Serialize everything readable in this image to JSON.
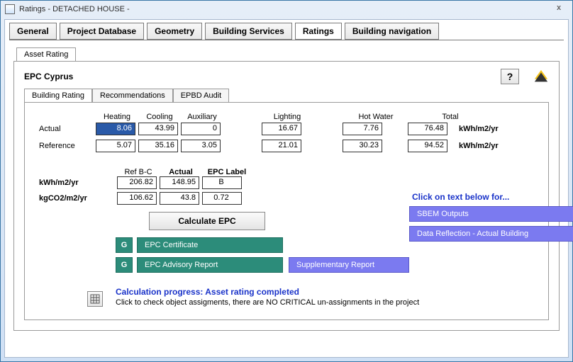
{
  "window": {
    "title": "Ratings - DETACHED HOUSE -",
    "close": "x"
  },
  "mainTabs": {
    "t0": "General",
    "t1": "Project Database",
    "t2": "Geometry",
    "t3": "Building Services",
    "t4": "Ratings",
    "t5": "Building navigation"
  },
  "subTab": "Asset Rating",
  "epcTitle": "EPC Cyprus",
  "helpGlyph": "?",
  "innerTabs": {
    "t0": "Building Rating",
    "t1": "Recommendations",
    "t2": "EPBD Audit"
  },
  "cols": {
    "heating": "Heating",
    "cooling": "Cooling",
    "aux": "Auxiliary",
    "lighting": "Lighting",
    "hotwater": "Hot Water",
    "total": "Total"
  },
  "rows": {
    "actual": "Actual",
    "reference": "Reference"
  },
  "vals": {
    "actual": {
      "heating": "8.06",
      "cooling": "43.99",
      "aux": "0",
      "lighting": "16.67",
      "hotwater": "7.76",
      "total": "76.48"
    },
    "reference": {
      "heating": "5.07",
      "cooling": "35.16",
      "aux": "3.05",
      "lighting": "21.01",
      "hotwater": "30.23",
      "total": "94.52"
    }
  },
  "unit": "kWh/m2/yr",
  "epcCols": {
    "ref": "Ref B-C",
    "actual": "Actual",
    "label": "EPC Label"
  },
  "epcRows": {
    "kwh": {
      "label": "kWh/m2/yr",
      "ref": "206.82",
      "actual": "148.95",
      "lab": "B"
    },
    "kgco2": {
      "label": "kgCO2/m2/yr",
      "ref": "106.62",
      "actual": "43.8",
      "lab": "0.72"
    }
  },
  "calc": "Calculate  EPC",
  "g1": "EPC Certificate",
  "g2": "EPC Advisory Report",
  "gBadge": "G",
  "supp": "Supplementary Report",
  "clickHdr": "Click on text below for...",
  "link1": "SBEM Outputs",
  "link2": "Data Reflection - Actual Building",
  "prog1": "Calculation progress: Asset rating completed",
  "prog2": "Click to check object assigments, there are NO CRITICAL un-assignments in the project"
}
